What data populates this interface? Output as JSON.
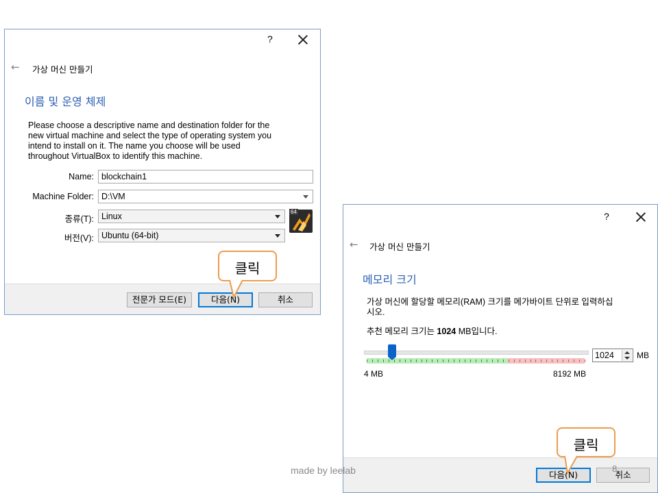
{
  "dialog1": {
    "help": "?",
    "window_title": "가상 머신 만들기",
    "heading": "이름 및 운영 체제",
    "description_lines": [
      "Please choose a descriptive name and destination folder for the",
      "new virtual machine and select the type of operating system you",
      "intend to install on it. The name you choose will be used",
      "throughout VirtualBox to identify this machine."
    ],
    "name_label": "Name:",
    "name_value": "blockchain1",
    "folder_label": "Machine Folder:",
    "folder_value": "D:\\VM",
    "type_label": "종류(T):",
    "type_value": "Linux",
    "version_label": "버전(V):",
    "version_value": "Ubuntu (64-bit)",
    "os_badge": "64",
    "expert_button": "전문가 모드(E)",
    "next_button": "다음(N)",
    "cancel_button": "취소"
  },
  "dialog2": {
    "help": "?",
    "window_title": "가상 머신 만들기",
    "heading": "메모리 크기",
    "description_lines": [
      "가상 머신에 할당할 메모리(RAM) 크기를 메가바이트 단위로 입력하십",
      "시오."
    ],
    "recommend_prefix": "추천 메모리 크기는 ",
    "recommend_value": "1024",
    "recommend_suffix": " MB입니다.",
    "memory_value": "1024",
    "memory_unit": "MB",
    "slider_min_label": "4 MB",
    "slider_max_label": "8192 MB",
    "memory_fraction": 0.125,
    "next_button": "다음(N)",
    "cancel_button": "취소"
  },
  "callout1": {
    "text": "클릭"
  },
  "callout2": {
    "text": "클릭"
  },
  "footer": {
    "text": "made by leelab",
    "page_number": "8"
  },
  "colors": {
    "heading": "#2a5fb3",
    "callout_border": "#ed9b4b",
    "primary_border": "#0078d7",
    "slider_thumb": "#0a64c8"
  }
}
